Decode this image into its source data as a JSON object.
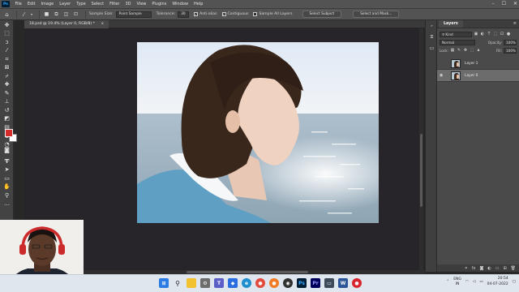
{
  "app": {
    "logo": "Ps"
  },
  "menu": [
    "File",
    "Edit",
    "Image",
    "Layer",
    "Type",
    "Select",
    "Filter",
    "3D",
    "View",
    "Plugins",
    "Window",
    "Help"
  ],
  "window_controls": [
    "–",
    "☐",
    "✕"
  ],
  "options_bar": {
    "sample_size_label": "Sample Size:",
    "sample_size_value": "Point Sample",
    "tolerance_label": "Tolerance:",
    "tolerance_value": "30",
    "anti_alias_label": "Anti-alias",
    "contiguous_label": "Contiguous",
    "sample_all_label": "Sample All Layers",
    "select_subject": "Select Subject",
    "select_and_mask": "Select and Mask..."
  },
  "document": {
    "tab_title": "18.psd @ 19.4% (Layer 0, RGB/8) *",
    "tab_close": "×"
  },
  "layers_panel": {
    "tab": "Layers",
    "filter_kind": "Kind",
    "blend_mode": "Normal",
    "opacity_label": "Opacity:",
    "opacity_value": "100%",
    "lock_label": "Lock:",
    "fill_label": "Fill:",
    "fill_value": "100%",
    "layers": [
      {
        "name": "Layer 1",
        "visible": false,
        "active": false
      },
      {
        "name": "Layer 0",
        "visible": true,
        "active": true
      }
    ]
  },
  "colors": {
    "foreground": "#d62b2b",
    "background": "#ffffff",
    "accent": "#31a8ff"
  },
  "taskbar": {
    "apps": [
      "windows-logo",
      "search",
      "file-explorer",
      "settings",
      "teams",
      "dropbox",
      "edge",
      "chrome",
      "firefox",
      "obs",
      "photoshop",
      "premiere",
      "files",
      "word",
      "red-app"
    ],
    "lang_top": "ENG",
    "lang_bottom": "IN",
    "time": "20:54",
    "date": "04-07-2022"
  }
}
